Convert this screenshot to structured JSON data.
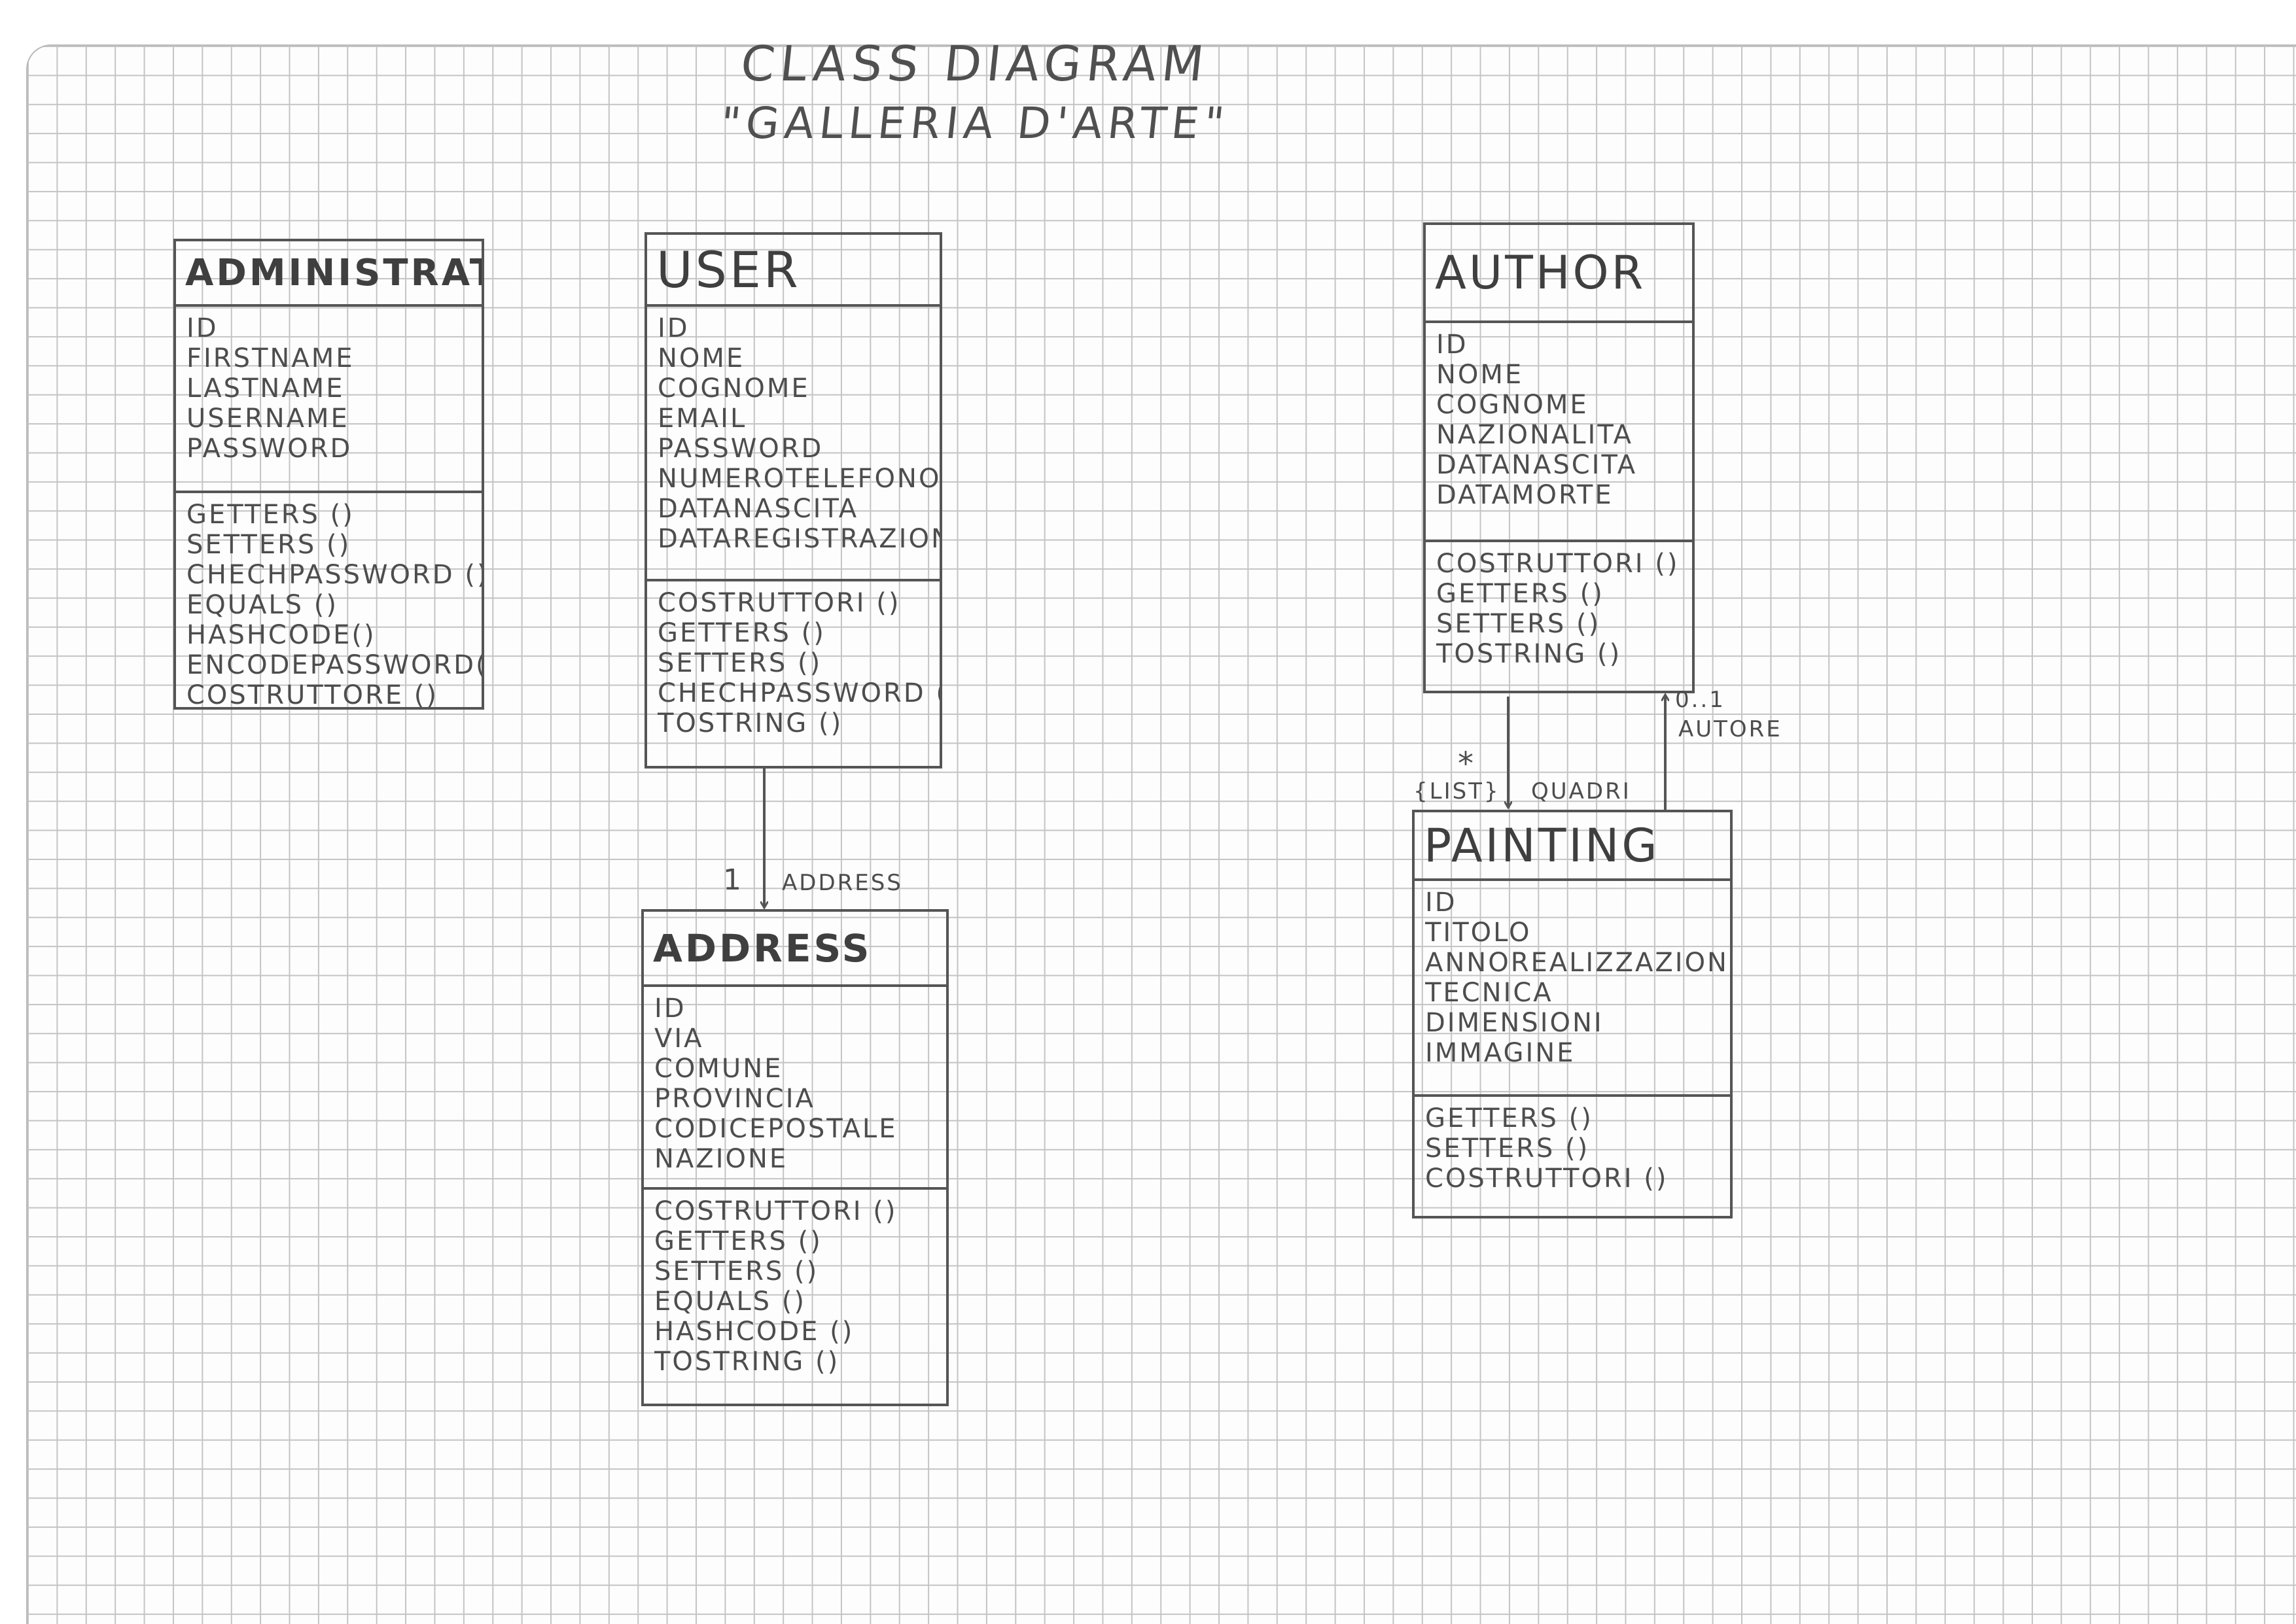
{
  "title": "CLASS DIAGRAM",
  "subtitle": "\"GALLERIA D'ARTE\"",
  "classes": {
    "administrator": {
      "name": "ADMINISTRATOR",
      "attributes": [
        "ID",
        "FIRSTNAME",
        "LASTNAME",
        "USERNAME",
        "PASSWORD"
      ],
      "methods": [
        "GETTERS ()",
        "SETTERS ()",
        "CHECHPASSWORD ()",
        "EQUALS ()",
        "HASHCODE()",
        "ENCODEPASSWORD()",
        "COSTRUTTORE ()"
      ]
    },
    "user": {
      "name": "USER",
      "attributes": [
        "ID",
        "NOME",
        "COGNOME",
        "EMAIL",
        "PASSWORD",
        "NUMEROTELEFONO",
        "DATANASCITA",
        "DATAREGISTRAZIONE"
      ],
      "methods": [
        "COSTRUTTORI ()",
        "GETTERS ()",
        "SETTERS ()",
        "CHECHPASSWORD ()",
        "TOSTRING ()"
      ]
    },
    "address": {
      "name": "ADDRESS",
      "attributes": [
        "ID",
        "VIA",
        "COMUNE",
        "PROVINCIA",
        "CODICEPOSTALE",
        "NAZIONE"
      ],
      "methods": [
        "COSTRUTTORI ()",
        "GETTERS ()",
        "SETTERS ()",
        "EQUALS ()",
        "HASHCODE ()",
        "TOSTRING ()"
      ]
    },
    "author": {
      "name": "AUTHOR",
      "attributes": [
        "ID",
        "NOME",
        "COGNOME",
        "NAZIONALITA",
        "DATANASCITA",
        "DATAMORTE"
      ],
      "methods": [
        "COSTRUTTORI ()",
        "GETTERS ()",
        "SETTERS ()",
        "TOSTRING ()"
      ]
    },
    "painting": {
      "name": "PAINTING",
      "attributes": [
        "ID",
        "TITOLO",
        "ANNOREALIZZAZIONE",
        "TECNICA",
        "DIMENSIONI",
        "IMMAGINE"
      ],
      "methods": [
        "GETTERS ()",
        "SETTERS ()",
        "COSTRUTTORI ()"
      ]
    }
  },
  "associations": {
    "user_address": {
      "multiplicity": "1",
      "role": "ADDRESS"
    },
    "author_painting": {
      "multiplicity": "*",
      "stereotype": "{LIST}",
      "role": "QUADRI"
    },
    "painting_author": {
      "multiplicity": "0..1",
      "role": "AUTORE"
    }
  }
}
